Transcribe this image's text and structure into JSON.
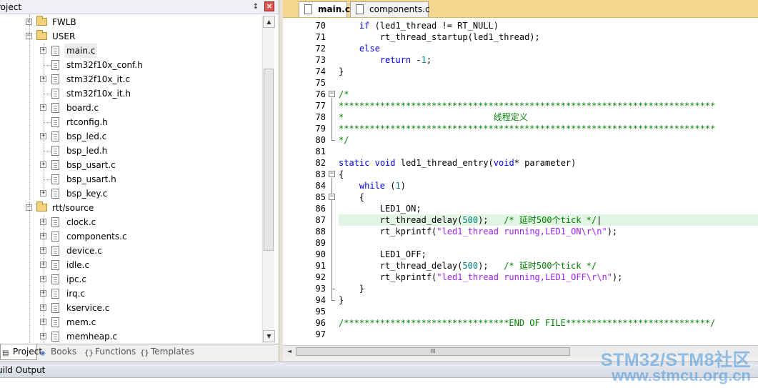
{
  "project_panel": {
    "title": "roject",
    "pin_glyph": "↕",
    "close_glyph": "×",
    "tree": [
      {
        "label": "FWLB",
        "kind": "folder",
        "toggle": "+"
      },
      {
        "label": "USER",
        "kind": "folder",
        "toggle": "−"
      },
      {
        "label": "main.c",
        "kind": "file",
        "toggle": "+",
        "selected": true
      },
      {
        "label": "stm32f10x_conf.h",
        "kind": "file",
        "toggle": ""
      },
      {
        "label": "stm32f10x_it.c",
        "kind": "file",
        "toggle": "+"
      },
      {
        "label": "stm32f10x_it.h",
        "kind": "file",
        "toggle": ""
      },
      {
        "label": "board.c",
        "kind": "file",
        "toggle": "+"
      },
      {
        "label": "rtconfig.h",
        "kind": "file",
        "toggle": ""
      },
      {
        "label": "bsp_led.c",
        "kind": "file",
        "toggle": "+"
      },
      {
        "label": "bsp_led.h",
        "kind": "file",
        "toggle": ""
      },
      {
        "label": "bsp_usart.c",
        "kind": "file",
        "toggle": "+"
      },
      {
        "label": "bsp_usart.h",
        "kind": "file",
        "toggle": ""
      },
      {
        "label": "bsp_key.c",
        "kind": "file",
        "toggle": "+"
      },
      {
        "label": "rtt/source",
        "kind": "folder",
        "toggle": "−"
      },
      {
        "label": "clock.c",
        "kind": "file",
        "toggle": "+"
      },
      {
        "label": "components.c",
        "kind": "file",
        "toggle": "+"
      },
      {
        "label": "device.c",
        "kind": "file",
        "toggle": "+"
      },
      {
        "label": "idle.c",
        "kind": "file",
        "toggle": "+"
      },
      {
        "label": "ipc.c",
        "kind": "file",
        "toggle": "+"
      },
      {
        "label": "irq.c",
        "kind": "file",
        "toggle": "+"
      },
      {
        "label": "kservice.c",
        "kind": "file",
        "toggle": "+"
      },
      {
        "label": "mem.c",
        "kind": "file",
        "toggle": "+"
      },
      {
        "label": "memheap.c",
        "kind": "file",
        "toggle": "+"
      }
    ],
    "tabs": [
      {
        "label": "Project",
        "icon": "project-icon"
      },
      {
        "label": "Books",
        "icon": "books-icon"
      },
      {
        "label": "Functions",
        "icon": "functions-icon"
      },
      {
        "label": "Templates",
        "icon": "templates-icon"
      }
    ],
    "scroll_up": "▲",
    "scroll_down": "▼"
  },
  "editor": {
    "tabs": [
      {
        "label": "main.c",
        "active": true
      },
      {
        "label": "components.c",
        "active": false
      }
    ],
    "hscroll_left": "◄",
    "hscroll_thumb": "III",
    "lines": [
      {
        "no": "70",
        "segs": [
          [
            "    ",
            ""
          ],
          [
            "if",
            "kw"
          ],
          [
            " (led1_thread != RT_NULL)",
            ""
          ]
        ]
      },
      {
        "no": "71",
        "segs": [
          [
            "        rt_thread_startup(led1_thread);",
            ""
          ]
        ]
      },
      {
        "no": "72",
        "segs": [
          [
            "    ",
            ""
          ],
          [
            "else",
            "kw"
          ]
        ]
      },
      {
        "no": "73",
        "segs": [
          [
            "        ",
            ""
          ],
          [
            "return",
            "kw"
          ],
          [
            " -",
            ""
          ],
          [
            "1",
            "num"
          ],
          [
            ";",
            ""
          ]
        ]
      },
      {
        "no": "74",
        "segs": [
          [
            "}",
            ""
          ]
        ]
      },
      {
        "no": "75",
        "segs": []
      },
      {
        "no": "76",
        "segs": [
          [
            "/*",
            "cm"
          ]
        ]
      },
      {
        "no": "77",
        "segs": [
          [
            "*************************************************************************",
            "cm"
          ]
        ]
      },
      {
        "no": "78",
        "segs": [
          [
            "*                             线程定义",
            "cm"
          ]
        ]
      },
      {
        "no": "79",
        "segs": [
          [
            "*************************************************************************",
            "cm"
          ]
        ]
      },
      {
        "no": "80",
        "segs": [
          [
            "*/",
            "cm"
          ]
        ]
      },
      {
        "no": "81",
        "segs": []
      },
      {
        "no": "82",
        "segs": [
          [
            "static",
            "kw"
          ],
          [
            " ",
            ""
          ],
          [
            "void",
            "kw"
          ],
          [
            " led1_thread_entry(",
            ""
          ],
          [
            "void",
            "kw"
          ],
          [
            "* parameter)",
            ""
          ]
        ]
      },
      {
        "no": "83",
        "segs": [
          [
            "{",
            ""
          ]
        ]
      },
      {
        "no": "84",
        "segs": [
          [
            "    ",
            ""
          ],
          [
            "while",
            "kw"
          ],
          [
            " (",
            ""
          ],
          [
            "1",
            "num"
          ],
          [
            ")",
            ""
          ]
        ]
      },
      {
        "no": "85",
        "segs": [
          [
            "    {",
            ""
          ]
        ]
      },
      {
        "no": "86",
        "segs": [
          [
            "        LED1_ON;",
            ""
          ]
        ]
      },
      {
        "no": "87",
        "segs": [
          [
            "        rt_thread_delay(",
            ""
          ],
          [
            "500",
            "num"
          ],
          [
            ");   ",
            ""
          ],
          [
            "/* 延时500个tick */",
            "cm"
          ],
          [
            "|",
            ""
          ]
        ],
        "highlight": true
      },
      {
        "no": "88",
        "segs": [
          [
            "        rt_kprintf(",
            ""
          ],
          [
            "\"led1_thread running,LED1_ON\\r\\n\"",
            "str"
          ],
          [
            ");",
            ""
          ]
        ]
      },
      {
        "no": "89",
        "segs": []
      },
      {
        "no": "90",
        "segs": [
          [
            "        LED1_OFF;",
            ""
          ]
        ]
      },
      {
        "no": "91",
        "segs": [
          [
            "        rt_thread_delay(",
            ""
          ],
          [
            "500",
            "num"
          ],
          [
            ");   ",
            ""
          ],
          [
            "/* 延时500个tick */",
            "cm"
          ]
        ]
      },
      {
        "no": "92",
        "segs": [
          [
            "        rt_kprintf(",
            ""
          ],
          [
            "\"led1_thread running,LED1_OFF\\r\\n\"",
            "str"
          ],
          [
            ");",
            ""
          ]
        ]
      },
      {
        "no": "93",
        "segs": [
          [
            "    }",
            ""
          ]
        ]
      },
      {
        "no": "94",
        "segs": [
          [
            "}",
            ""
          ]
        ]
      },
      {
        "no": "95",
        "segs": []
      },
      {
        "no": "96",
        "segs": [
          [
            "/********************************END OF FILE****************************/",
            "cm"
          ]
        ]
      },
      {
        "no": "97",
        "segs": []
      }
    ]
  },
  "build_output": {
    "title": "uild Output"
  },
  "watermark": {
    "line1": "STM32/STM8社区",
    "line2": "www.stmcu.org.cn"
  },
  "colors": {
    "keyword": "#0000ff",
    "comment": "#008000",
    "string": "#a020f0",
    "number": "#008080",
    "tab_strip": "#f5d68e",
    "current_line": "#e2f5e4"
  }
}
